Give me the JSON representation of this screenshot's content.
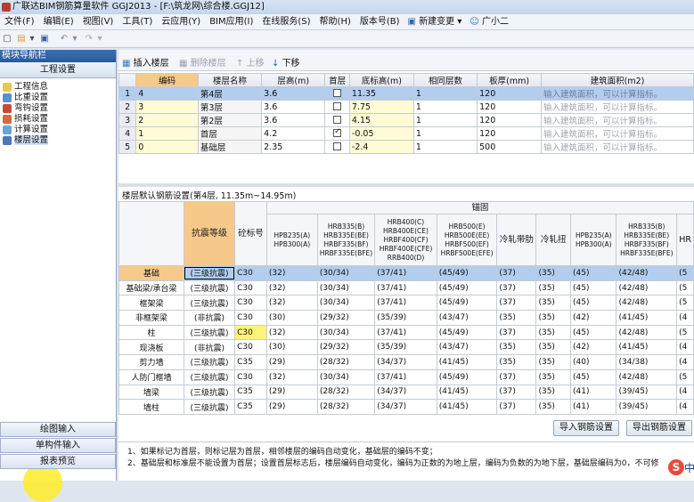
{
  "window": {
    "title": "广联达BIM钢筋算量软件 GGJ2013 - [F:\\筑龙网\\综合楼.GGJ12]"
  },
  "menu": {
    "items": [
      "文件(F)",
      "编辑(E)",
      "视图(V)",
      "工具(T)",
      "云应用(Y)",
      "BIM应用(I)",
      "在线服务(S)",
      "帮助(H)",
      "版本号(B)"
    ],
    "new_change": "新建变更",
    "assistant": "广小二"
  },
  "nav": {
    "title": "模块导航栏",
    "tab": "工程设置",
    "items": [
      {
        "label": "工程信息",
        "icon": "info-icon"
      },
      {
        "label": "比重设置",
        "icon": "ratio-icon"
      },
      {
        "label": "弯钩设置",
        "icon": "hook-icon"
      },
      {
        "label": "损耗设置",
        "icon": "loss-icon"
      },
      {
        "label": "计算设置",
        "icon": "calc-icon"
      },
      {
        "label": "楼层设置",
        "icon": "floor-icon"
      }
    ],
    "bottom_buttons": [
      "绘图输入",
      "单构件输入",
      "报表预览"
    ]
  },
  "floor_toolbar": {
    "insert": "插入楼层",
    "delete": "删除楼层",
    "up": "上移",
    "down": "下移"
  },
  "floor_table": {
    "headers": [
      "编码",
      "楼层名称",
      "层高(m)",
      "首层",
      "底标高(m)",
      "相同层数",
      "板厚(mm)",
      "建筑面积(m2)"
    ],
    "rows": [
      {
        "n": "1",
        "code": "4",
        "name": "第4层",
        "height": "3.6",
        "first": false,
        "bottom": "11.35",
        "same": "1",
        "thick": "120",
        "area": "输入建筑面积，可以计算指标。"
      },
      {
        "n": "2",
        "code": "3",
        "name": "第3层",
        "height": "3.6",
        "first": false,
        "bottom": "7.75",
        "same": "1",
        "thick": "120",
        "area": "输入建筑面积，可以计算指标。"
      },
      {
        "n": "3",
        "code": "2",
        "name": "第2层",
        "height": "3.6",
        "first": false,
        "bottom": "4.15",
        "same": "1",
        "thick": "120",
        "area": "输入建筑面积，可以计算指标。"
      },
      {
        "n": "4",
        "code": "1",
        "name": "首层",
        "height": "4.2",
        "first": true,
        "bottom": "-0.05",
        "same": "1",
        "thick": "120",
        "area": "输入建筑面积，可以计算指标。"
      },
      {
        "n": "5",
        "code": "0",
        "name": "基础层",
        "height": "2.35",
        "first": false,
        "bottom": "-2.4",
        "same": "1",
        "thick": "500",
        "area": "输入建筑面积，可以计算指标。"
      }
    ],
    "selected_row": 0
  },
  "rebar": {
    "title": "楼层默认钢筋设置(第4层, 11.35m~14.95m)",
    "group_header": "锚固",
    "grade_header": "抗震等级",
    "concrete_header": "砼标号",
    "col_headers": [
      "HPB235(A)\nHPB300(A)",
      "HRB335(B)\nHRB335E(BE)\nHRBF335(BF)\nHRBF335E(BFE)",
      "HRB400(C)\nHRB400E(CE)\nHRBF400(CF)\nHRBF400E(CFE)\nRRB400(D)",
      "HRB500(E)\nHRB500E(EE)\nHRBF500(EF)\nHRBF500E(EFE)",
      "冷轧带肋",
      "冷轧扭",
      "HPB235(A)\nHPB300(A)",
      "HRB335(B)\nHRB335E(BE)\nHRBF335(BF)\nHRBF335E(BFE)",
      "HR"
    ],
    "rows": [
      {
        "cat": "基础",
        "grade": "(三级抗震)",
        "conc": "C30",
        "v": [
          "(32)",
          "(30/34)",
          "(37/41)",
          "(45/49)",
          "(37)",
          "(35)",
          "(45)",
          "(42/48)",
          "(5"
        ]
      },
      {
        "cat": "基础梁/承台梁",
        "grade": "(三级抗震)",
        "conc": "C30",
        "v": [
          "(32)",
          "(30/34)",
          "(37/41)",
          "(45/49)",
          "(37)",
          "(35)",
          "(45)",
          "(42/48)",
          "(5"
        ]
      },
      {
        "cat": "框架梁",
        "grade": "(三级抗震)",
        "conc": "C30",
        "v": [
          "(32)",
          "(30/34)",
          "(37/41)",
          "(45/49)",
          "(37)",
          "(35)",
          "(45)",
          "(42/48)",
          "(5"
        ]
      },
      {
        "cat": "非框架梁",
        "grade": "(非抗震)",
        "conc": "C30",
        "v": [
          "(30)",
          "(29/32)",
          "(35/39)",
          "(43/47)",
          "(35)",
          "(35)",
          "(42)",
          "(41/45)",
          "(4"
        ]
      },
      {
        "cat": "柱",
        "grade": "(三级抗震)",
        "conc": "C30",
        "v": [
          "(32)",
          "(30/34)",
          "(37/41)",
          "(45/49)",
          "(37)",
          "(35)",
          "(45)",
          "(42/48)",
          "(5"
        ]
      },
      {
        "cat": "现浇板",
        "grade": "(非抗震)",
        "conc": "C30",
        "v": [
          "(30)",
          "(29/32)",
          "(35/39)",
          "(43/47)",
          "(35)",
          "(35)",
          "(42)",
          "(41/45)",
          "(4"
        ]
      },
      {
        "cat": "剪力墙",
        "grade": "(三级抗震)",
        "conc": "C35",
        "v": [
          "(29)",
          "(28/32)",
          "(34/37)",
          "(41/45)",
          "(35)",
          "(35)",
          "(40)",
          "(34/38)",
          "(4"
        ]
      },
      {
        "cat": "人防门框墙",
        "grade": "(三级抗震)",
        "conc": "C30",
        "v": [
          "(32)",
          "(30/34)",
          "(37/41)",
          "(45/49)",
          "(37)",
          "(35)",
          "(45)",
          "(42/48)",
          "(5"
        ]
      },
      {
        "cat": "墙梁",
        "grade": "(三级抗震)",
        "conc": "C35",
        "v": [
          "(29)",
          "(28/32)",
          "(34/37)",
          "(41/45)",
          "(37)",
          "(35)",
          "(41)",
          "(39/45)",
          "(4"
        ]
      },
      {
        "cat": "墙柱",
        "grade": "(三级抗震)",
        "conc": "C35",
        "v": [
          "(29)",
          "(28/32)",
          "(34/37)",
          "(41/45)",
          "(37)",
          "(35)",
          "(41)",
          "(39/45)",
          "(4"
        ]
      }
    ],
    "import_button": "导入钢筋设置",
    "export_button": "导出钢筋设置"
  },
  "notes": {
    "line1": "1、如果标记为首层，则标记层为首层，相邻楼层的编码自动变化，基础层的编码不变；",
    "line2": "2、基础层和标准层不能设置为首层；设置首层标志后，楼层编码自动变化，编码为正数的为地上层，编码为负数的为地下层，基础层编码为0，不可修"
  },
  "watermark": {
    "char": "S",
    "text": "中"
  },
  "colors": {
    "header_accent": "#f6c98b",
    "selection": "#b3cdee",
    "nav_header": "#2b5a9c",
    "highlight_circle": "#ffec28"
  }
}
